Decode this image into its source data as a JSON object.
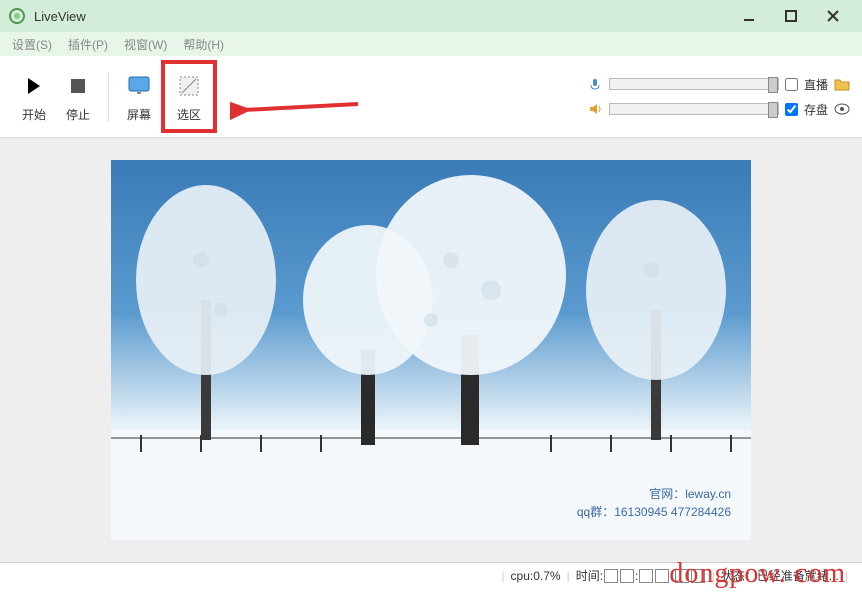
{
  "window": {
    "title": "LiveView"
  },
  "menu": {
    "settings": "设置(S)",
    "plugin": "插件(P)",
    "view": "视窗(W)",
    "help": "帮助(H)"
  },
  "toolbar": {
    "start": "开始",
    "stop": "停止",
    "screen": "屏幕",
    "region": "选区"
  },
  "controls": {
    "live_label": "直播",
    "save_label": "存盘",
    "live_checked": false,
    "save_checked": true
  },
  "preview_image": {
    "site_label": "官网：",
    "site_value": "leway.cn",
    "qq_label": "qq群：",
    "qq_value": "16130945 477284426"
  },
  "status": {
    "cpu_label": "cpu:",
    "cpu_value": "0.7%",
    "time_label": "时间:",
    "state_label": "状态：",
    "state_value": "已经准备就绪..."
  },
  "watermark": "dongpow. com"
}
